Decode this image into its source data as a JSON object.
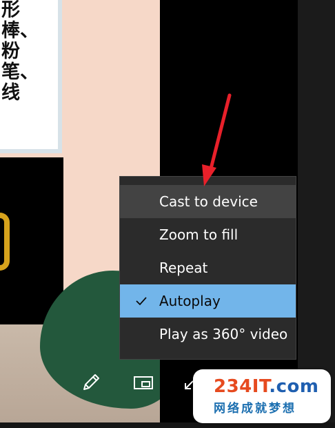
{
  "background": {
    "paper_text": "形\n棒、\n粉\n笔、\n线"
  },
  "context_menu": {
    "items": [
      {
        "label": "Cast to device",
        "state": "hover"
      },
      {
        "label": "Zoom to fill",
        "state": "normal"
      },
      {
        "label": "Repeat",
        "state": "normal"
      },
      {
        "label": "Autoplay",
        "state": "checked"
      },
      {
        "label": "Play as 360° video",
        "state": "normal"
      }
    ],
    "checked_icon": "checkmark-icon"
  },
  "toolbar": {
    "icons": [
      "pencil-icon",
      "picture-in-picture-icon",
      "collapse-arrow-icon"
    ]
  },
  "watermark": {
    "site_number": "234",
    "site_word": "IT",
    "site_tld": ".com",
    "tagline": "网络成就梦想"
  },
  "colors": {
    "menu_bg": "#2b2b2b",
    "menu_hover": "#434343",
    "menu_selected": "#72b5ea",
    "annotation_arrow": "#e8202a"
  }
}
